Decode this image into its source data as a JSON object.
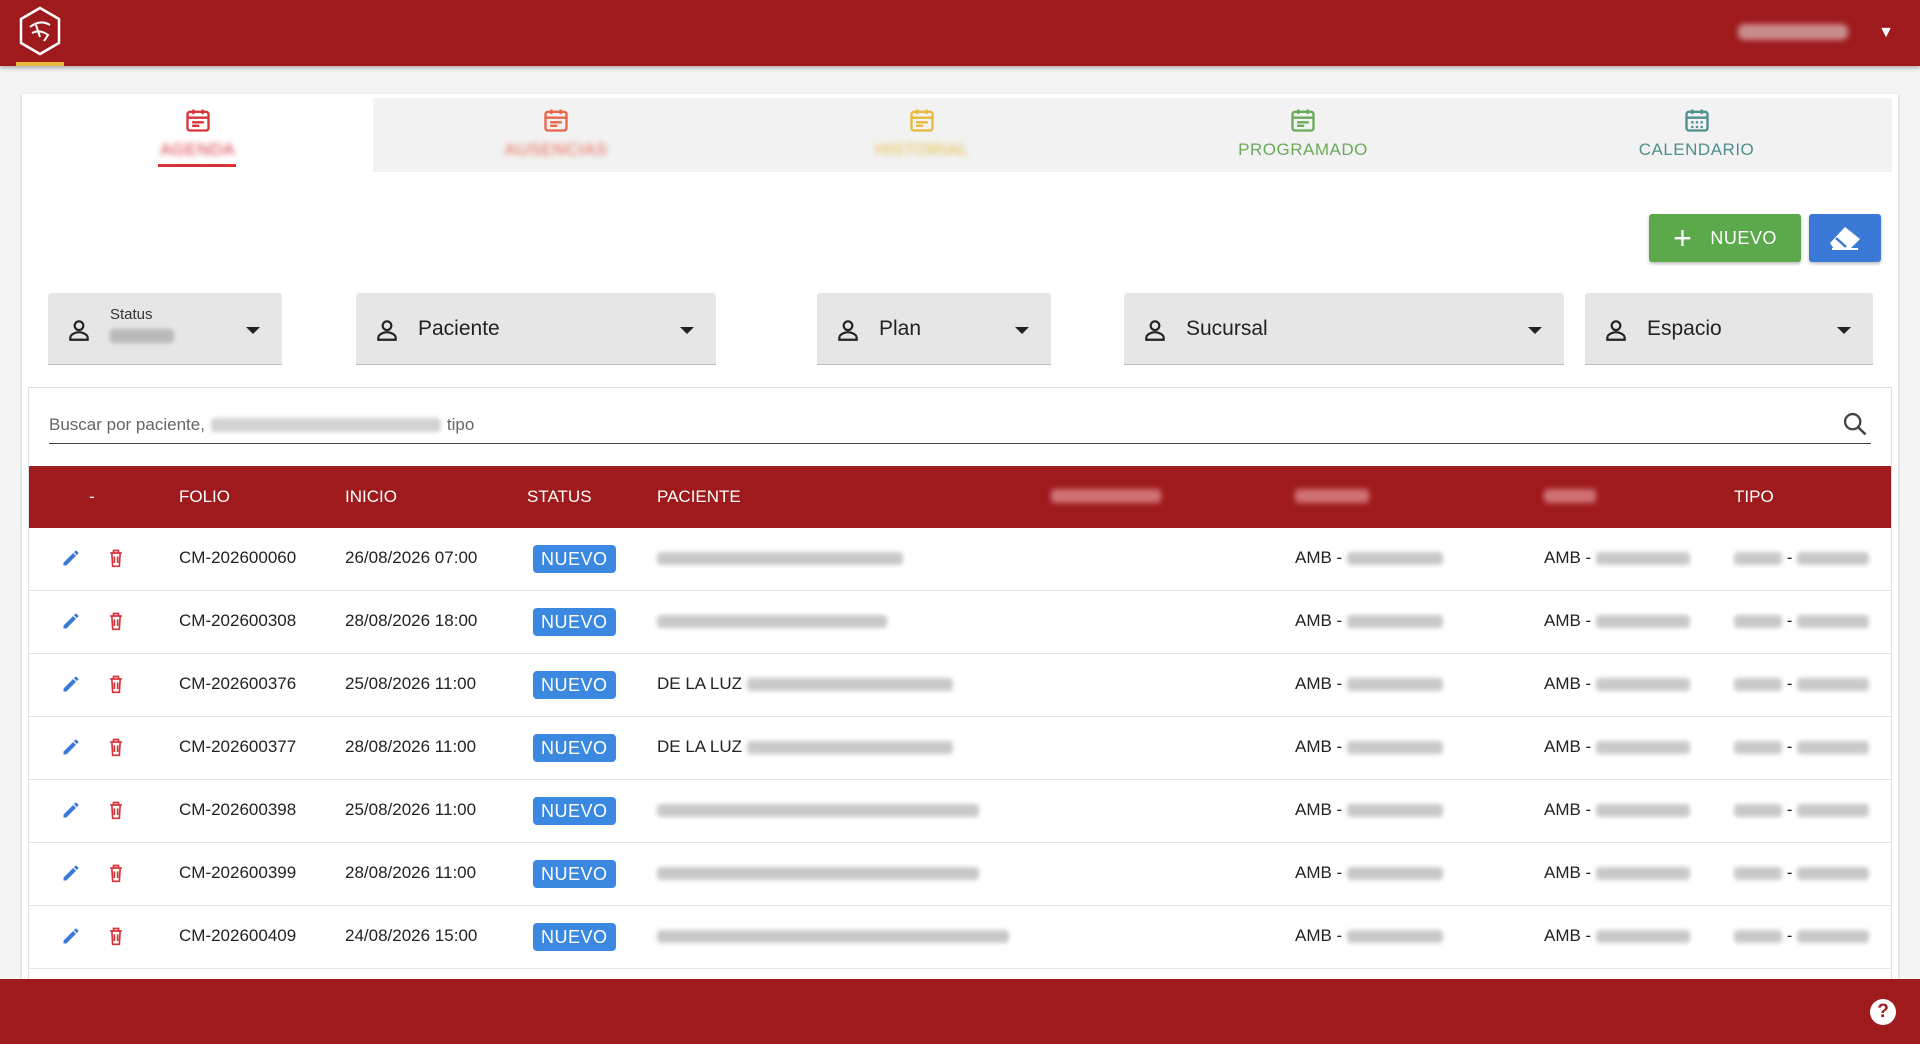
{
  "header": {
    "logo": "clinic-logo",
    "user_name": "NMTR MACM",
    "user_menu_icon": "caret-down-icon"
  },
  "tabs": [
    {
      "label": "AGENDA",
      "icon": "calendar-icon",
      "color": "#d9333a"
    },
    {
      "label": "AUSENCIAS",
      "icon": "calendar-icon",
      "color": "#e8664a"
    },
    {
      "label": "HISTORIAL",
      "icon": "calendar-icon",
      "color": "#e8b93a"
    },
    {
      "label": "PROGRAMADO",
      "icon": "calendar-icon",
      "color": "#6aab5a"
    },
    {
      "label": "CALENDARIO",
      "icon": "calendar-grid-icon",
      "color": "#4f8f8b"
    }
  ],
  "actions": {
    "new_label": "NUEVO",
    "new_color": "#5ba94b",
    "clear_icon": "eraser-icon",
    "clear_color": "#3b79d6"
  },
  "filters": {
    "status": {
      "label": "Status",
      "value": "TODOS"
    },
    "paciente": {
      "label": "Paciente"
    },
    "plan": {
      "label": "Plan"
    },
    "sucursal": {
      "label": "Sucursal"
    },
    "espacio": {
      "label": "Espacio"
    }
  },
  "search": {
    "placeholder_start": "Buscar por paciente,",
    "placeholder_blurred": "especialista, regimen, clase",
    "placeholder_end": "tipo"
  },
  "table": {
    "headers": {
      "actions": "-",
      "folio": "FOLIO",
      "inicio": "INICIO",
      "status": "STATUS",
      "paciente": "PACIENTE",
      "especialista": "ESPECIALISTA",
      "regimen": "REGIMEN",
      "clase": "CLASE",
      "tipo": "TIPO"
    },
    "rows": [
      {
        "folio": "CM-202600060",
        "inicio": "26/08/2026 07:00",
        "status": "NUEVO",
        "paciente_prefix": "",
        "regimen": "AMB -",
        "clase": "AMB -",
        "tipo": "-"
      },
      {
        "folio": "CM-202600308",
        "inicio": "28/08/2026 18:00",
        "status": "NUEVO",
        "paciente_prefix": "",
        "regimen": "AMB -",
        "clase": "AMB -",
        "tipo": "-"
      },
      {
        "folio": "CM-202600376",
        "inicio": "25/08/2026 11:00",
        "status": "NUEVO",
        "paciente_prefix": "DE LA LUZ",
        "regimen": "AMB -",
        "clase": "AMB -",
        "tipo": "-"
      },
      {
        "folio": "CM-202600377",
        "inicio": "28/08/2026 11:00",
        "status": "NUEVO",
        "paciente_prefix": "DE LA LUZ",
        "regimen": "AMB -",
        "clase": "AMB -",
        "tipo": "-"
      },
      {
        "folio": "CM-202600398",
        "inicio": "25/08/2026 11:00",
        "status": "NUEVO",
        "paciente_prefix": "",
        "regimen": "AMB -",
        "clase": "AMB -",
        "tipo": "-"
      },
      {
        "folio": "CM-202600399",
        "inicio": "28/08/2026 11:00",
        "status": "NUEVO",
        "paciente_prefix": "",
        "regimen": "AMB -",
        "clase": "AMB -",
        "tipo": "-"
      },
      {
        "folio": "CM-202600409",
        "inicio": "24/08/2026 15:00",
        "status": "NUEVO",
        "paciente_prefix": "",
        "regimen": "AMB -",
        "clase": "AMB -",
        "tipo": "-"
      }
    ]
  },
  "footer": {
    "help_icon": "help-icon",
    "help_label": "?"
  }
}
